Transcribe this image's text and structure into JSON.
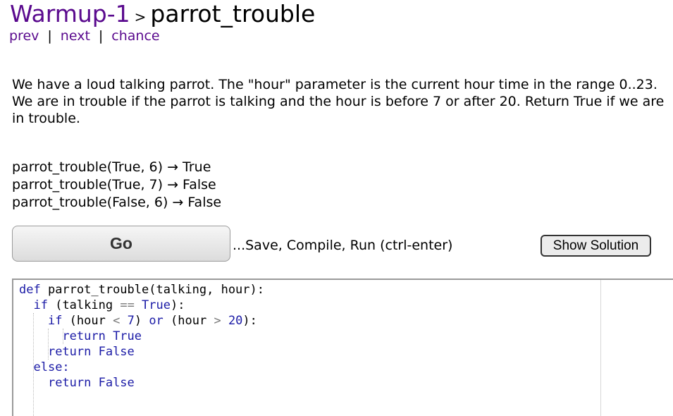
{
  "breadcrumb": {
    "section": "Warmup-1",
    "separator": ">",
    "title": "parrot_trouble"
  },
  "nav": {
    "prev": "prev",
    "next": "next",
    "chance": "chance",
    "pipe": "|"
  },
  "description": "We have a loud talking parrot. The \"hour\" parameter is the current hour time in the range 0..23. We are in trouble if the parrot is talking and the hour is before 7 or after 20. Return True if we are in trouble.",
  "examples": [
    "parrot_trouble(True, 6) → True",
    "parrot_trouble(True, 7) → False",
    "parrot_trouble(False, 6) → False"
  ],
  "controls": {
    "go_label": "Go",
    "go_note": "...Save, Compile, Run (ctrl-enter)",
    "solution_label": "Show Solution"
  },
  "code": {
    "l1_def": "def",
    "l1_sig": " parrot_trouble(talking, hour):",
    "l2_if": "if",
    "l2_a": " (talking ",
    "l2_op": "==",
    "l2_true": " True",
    "l2_b": "):",
    "l3_if": "if",
    "l3_a": " (hour ",
    "l3_op1": "<",
    "l3_n1": " 7",
    "l3_b": ") ",
    "l3_or": "or",
    "l3_c": " (hour ",
    "l3_op2": ">",
    "l3_n2": " 20",
    "l3_d": "):",
    "l4": "return True",
    "l5": "return False",
    "l6": "else:",
    "l7": "return False"
  }
}
